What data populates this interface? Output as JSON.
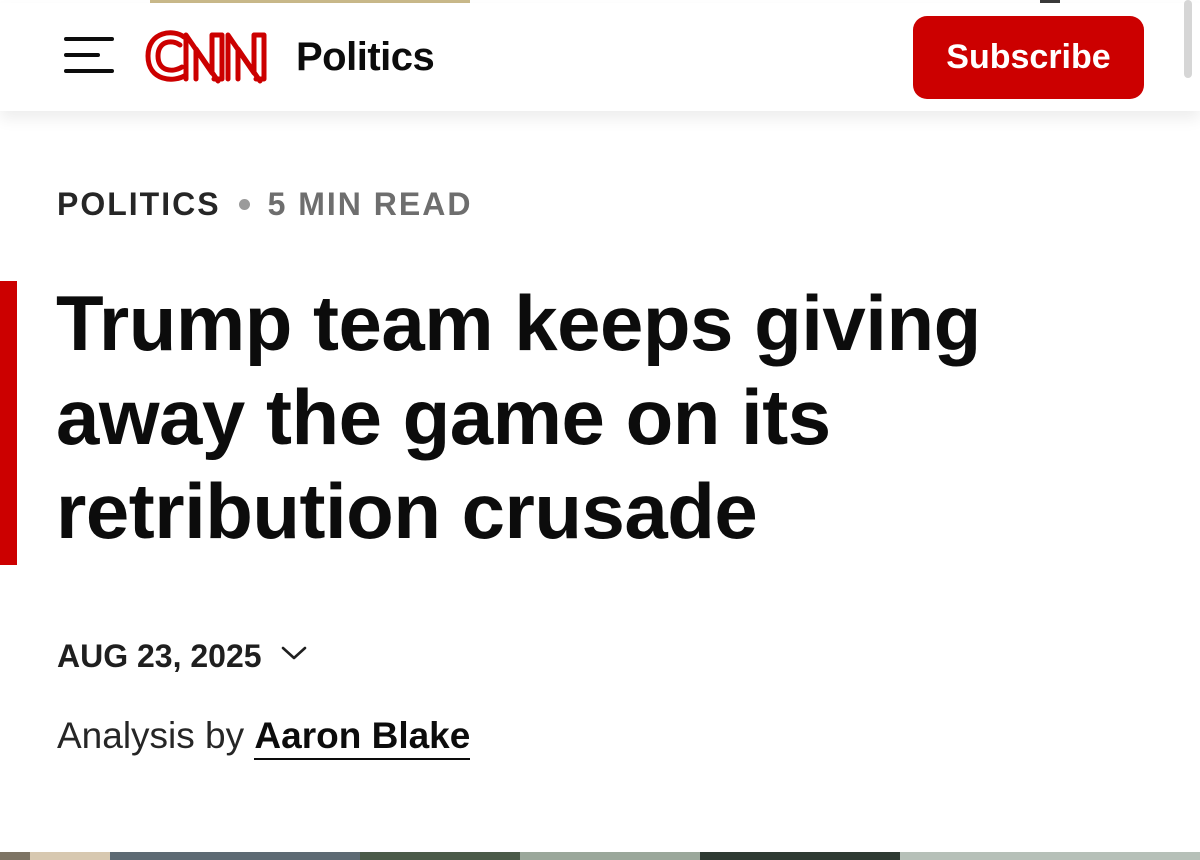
{
  "header": {
    "logo_text": "CNN",
    "section_name": "Politics",
    "subscribe_label": "Subscribe",
    "brand_color": "#cc0000",
    "menu_icon": "hamburger-menu-icon"
  },
  "article": {
    "kicker_section": "POLITICS",
    "read_time": "5 MIN READ",
    "headline": "Trump team keeps giving away the game on its retribution crusade",
    "date": "AUG 23, 2025",
    "byline_prefix": "Analysis by",
    "author": "Aaron Blake",
    "accent_color": "#cc0000"
  }
}
